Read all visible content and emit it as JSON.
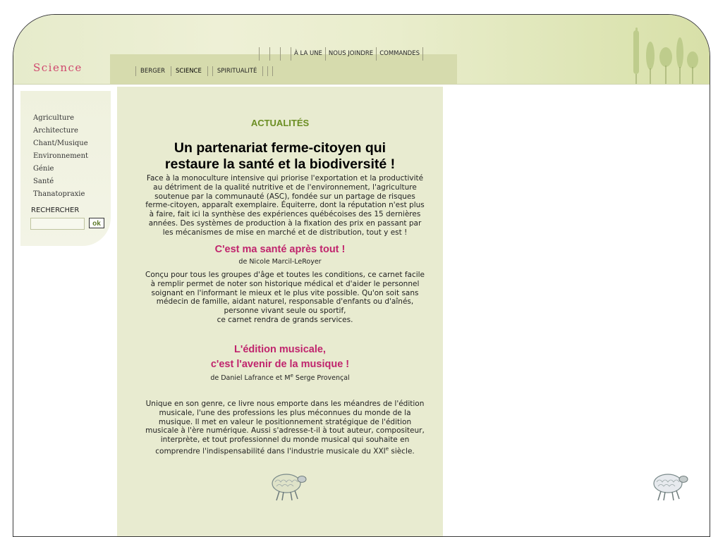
{
  "site": {
    "logo": "Science"
  },
  "top_nav": {
    "items": [
      "À LA UNE",
      "NOUS JOINDRE",
      "COMMANDES"
    ]
  },
  "sub_nav": {
    "items": [
      "BERGER",
      "SCIENCE",
      "SPIRITUALITÉ"
    ],
    "active": "SCIENCE"
  },
  "sidebar": {
    "items": [
      "Agriculture",
      "Architecture",
      "Chant/Musique",
      "Environnement",
      "Génie",
      "Santé",
      "Thanatopraxie"
    ],
    "search_label": "RECHERCHER",
    "search_value": "",
    "search_button": "ok"
  },
  "main": {
    "section_title": "ACTUALITÉS",
    "article1": {
      "title_line1": "Un partenariat ferme-citoyen qui",
      "title_line2": "restaure la santé et la biodiversité !",
      "body": [
        "Face à la monoculture intensive qui priorise l'exportation et la productivité",
        "au détriment de la qualité nutritive et de l'environnement, l'agriculture",
        "soutenue par la communauté (ASC), fondée sur un partage de risques",
        "ferme-citoyen, apparaît exemplaire. Équiterre, dont la réputation n'est plus",
        "à faire, fait ici la synthèse des expériences québécoises des 15 dernières",
        "années. Des systèmes de production à la fixation des prix en passant par",
        "les mécanismes de mise en marché et de distribution, tout y est  !"
      ]
    },
    "article2": {
      "title": "C'est ma santé après tout !",
      "author": "de Nicole Marcil-LeRoyer",
      "body": [
        "Conçu pour tous les groupes d'âge et toutes les conditions, ce carnet facile",
        "à remplir permet de noter son historique médical et d'aider le personnel",
        "soignant en l'informant le mieux et le plus vite possible. Qu'on soit sans",
        "médecin de famille, aidant naturel, responsable d'enfants ou d'aînés,",
        "personne vivant seule ou sportif,",
        "ce carnet rendra de grands services."
      ]
    },
    "article3": {
      "title_line1": "L'édition musicale,",
      "title_line2": "c'est l'avenir de la musique !",
      "author_pre": "de Daniel Lafrance et M",
      "author_sup": "e",
      "author_post": " Serge Provençal",
      "body": [
        "Unique en son genre, ce livre nous emporte dans les méandres de l'édition",
        "musicale, l'une des professions les plus méconnues du monde de la",
        "musique. Il met en valeur le positionnement stratégique de l'édition",
        "musicale à l'ère numérique. Aussi s'adresse-t-il à tout auteur, compositeur,",
        "interprète, et tout professionnel du monde musical qui souhaite en"
      ],
      "last_line_pre": "comprendre l'indispensabilité dans l'industrie musicale du XXI",
      "last_line_sup": "e",
      "last_line_post": " siècle."
    }
  },
  "icons": {
    "sheep": "sheep-icon",
    "trees": "trees-illustration"
  },
  "colors": {
    "accent_green": "#6b8e23",
    "headline_pink": "#c0246d",
    "logo_pink": "#d0486e",
    "content_bg": "#e8ebd0"
  }
}
